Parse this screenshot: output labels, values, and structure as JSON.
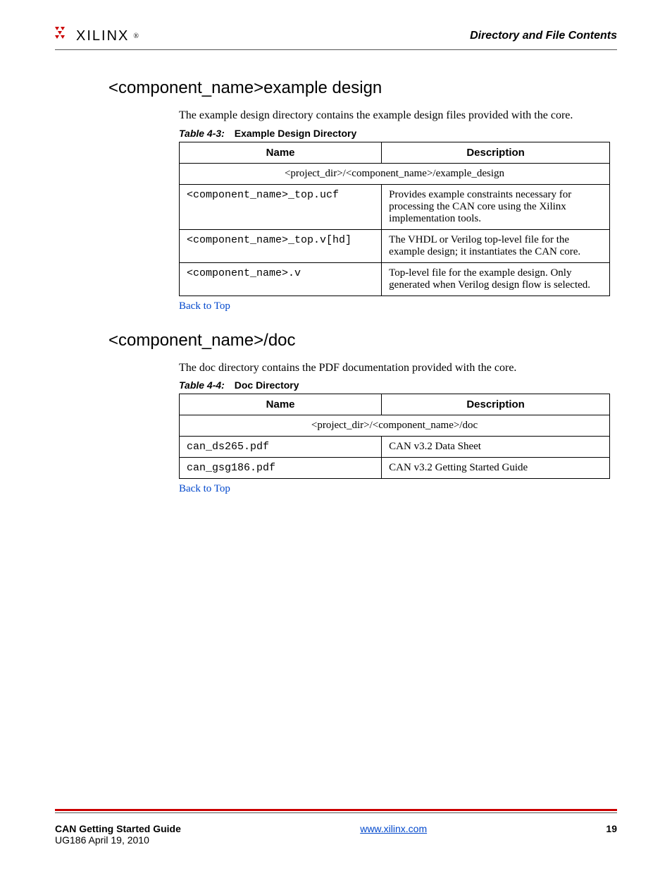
{
  "header": {
    "logo_brand": "XILINX",
    "section_title": "Directory and File Contents"
  },
  "section1": {
    "heading": "<component_name>example design",
    "intro": "The example design directory contains the example design files provided with the core.",
    "table_caption_label": "Table 4-3:",
    "table_caption_text": "Example Design Directory",
    "columns": [
      "Name",
      "Description"
    ],
    "path_row": "<project_dir>/<component_name>/example_design",
    "rows": [
      {
        "name": "<component_name>_top.ucf",
        "desc": "Provides example constraints necessary for processing the CAN core using the Xilinx implementation tools."
      },
      {
        "name": "<component_name>_top.v[hd]",
        "desc": "The VHDL or Verilog top-level file for the example design; it instantiates the CAN core."
      },
      {
        "name": "<component_name>.v",
        "desc": "Top-level file for the example design. Only generated when Verilog design flow is selected."
      }
    ],
    "back_link": "Back to Top"
  },
  "section2": {
    "heading": "<component_name>/doc",
    "intro": "The doc directory contains the PDF documentation provided with the core.",
    "table_caption_label": "Table 4-4:",
    "table_caption_text": "Doc Directory",
    "columns": [
      "Name",
      "Description"
    ],
    "path_row": "<project_dir>/<component_name>/doc",
    "rows": [
      {
        "name": "can_ds265.pdf",
        "desc": "CAN v3.2 Data Sheet"
      },
      {
        "name": "can_gsg186.pdf",
        "desc": "CAN v3.2 Getting Started Guide"
      }
    ],
    "back_link": "Back to Top"
  },
  "footer": {
    "doc_title": "CAN Getting Started Guide",
    "doc_id": "UG186 April 19, 2010",
    "url": "www.xilinx.com",
    "page_number": "19"
  }
}
